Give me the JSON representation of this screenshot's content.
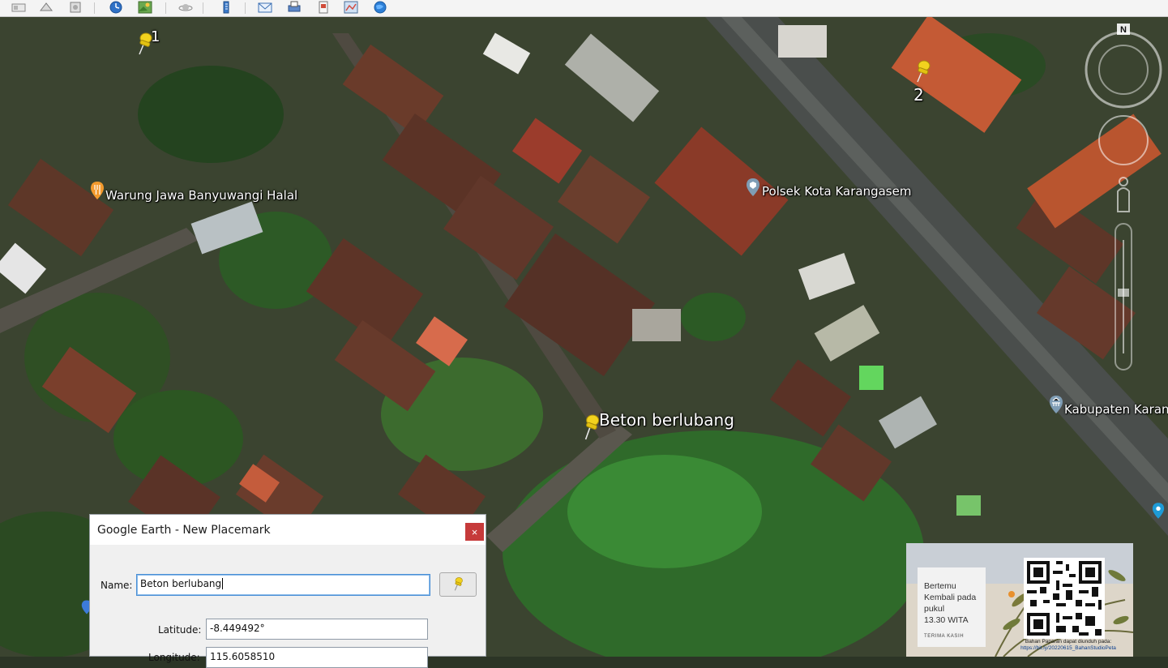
{
  "map": {
    "compass_north": "N",
    "placemarks": [
      {
        "label": "1"
      },
      {
        "label": "2"
      },
      {
        "label": "Beton berlubang"
      }
    ],
    "poi_labels": [
      {
        "text": "Warung Jawa Banyuwangi Halal"
      },
      {
        "text": "Polsek Kota Karangasem"
      },
      {
        "text": "Kabupaten Karan"
      }
    ]
  },
  "dialog": {
    "title": "Google Earth - New Placemark",
    "close_glyph": "×",
    "name_label": "Name:",
    "name_value": "Beton berlubang",
    "latitude_label": "Latitude:",
    "latitude_value": "-8.449492°",
    "longitude_label": "Longitude:",
    "longitude_value": "115.6058510"
  },
  "overlay_card": {
    "message": "Bertemu\nKembali pada\npukul\n13.30 WITA",
    "thanks": "TERIMA KASIH",
    "footer_text": "Bahan Paparan dapat diunduh pada:",
    "footer_link": "https://bit.ly/20220615_BahanStudioPeta"
  },
  "colors": {
    "pin_yellow": "#f2d21e",
    "close_red": "#c63a3a",
    "focus_blue": "#4a8fd6"
  }
}
